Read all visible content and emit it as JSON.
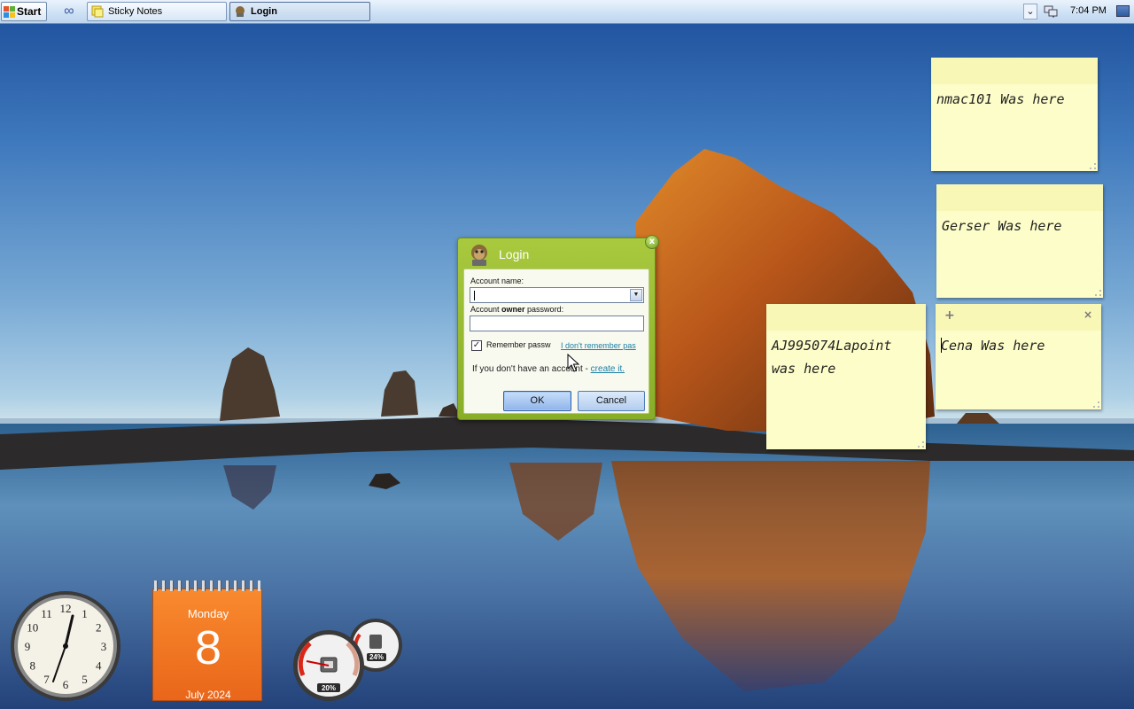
{
  "taskbar": {
    "start_label": "Start",
    "quick_launch_icon": "infinity-icon",
    "tasks": [
      {
        "label": "Sticky Notes",
        "icon": "sticky-notes-icon",
        "active": false
      },
      {
        "label": "Login",
        "icon": "login-app-icon",
        "active": true
      }
    ],
    "tray": {
      "chevron_icon": "chevron-down-icon",
      "network_icon": "network-icon",
      "time": "7:04 PM",
      "show_desktop_icon": "show-desktop-icon"
    }
  },
  "sticky_notes": [
    {
      "text": "nmac101 Was here"
    },
    {
      "text": "Gerser Was here"
    },
    {
      "text": "AJ995074Lapoint was here"
    },
    {
      "text": "Cena Was here",
      "add_label": "+",
      "close_label": "×"
    }
  ],
  "login_dialog": {
    "title": "Login",
    "close_label": "x",
    "account_name_label": "Account name:",
    "account_name_value": "",
    "password_label_pre": "Account ",
    "password_label_bold": "owner",
    "password_label_post": " password:",
    "password_value": "",
    "remember_label": "Remember passw",
    "remember_checked": true,
    "forgot_link": "I don't remember pas",
    "no_account_text": "If you don't have an account - ",
    "create_link": "create it.",
    "ok_label": "OK",
    "cancel_label": "Cancel"
  },
  "gadgets": {
    "clock": {
      "numerals": [
        "12",
        "1",
        "2",
        "3",
        "4",
        "5",
        "6",
        "7",
        "8",
        "9",
        "10",
        "11"
      ]
    },
    "calendar": {
      "day": "Monday",
      "date": "8",
      "month_year": "July 2024"
    },
    "meters": {
      "cpu_percent": "20%",
      "memory_percent": "24%",
      "cpu_value": 20,
      "memory_value": 24
    }
  },
  "colors": {
    "dialog_green": "#9bbd33",
    "note_yellow": "#fdfdc9",
    "calendar_orange": "#f47a24",
    "link_blue": "#1a7fa6"
  }
}
